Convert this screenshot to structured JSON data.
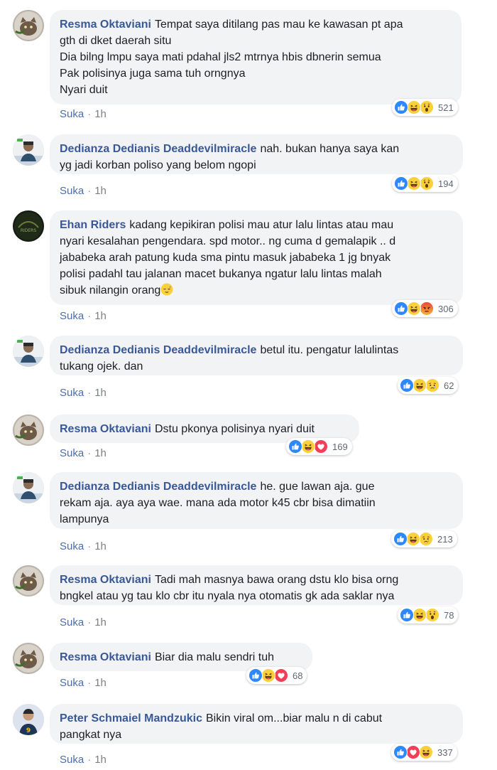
{
  "like_label": "Suka",
  "separator": "·",
  "colors": {
    "author": "#385898",
    "bubble": "#f2f3f5",
    "like": "#4b6ea9"
  },
  "comments": [
    {
      "author": "Resma Oktaviani",
      "lines": [
        "Tempat saya ditilang pas mau ke kawasan pt apa",
        "gth di dket daerah situ",
        "Dia bilng lmpu saya mati pdahal jls2 mtrnya hbis dbnerin semua",
        "Pak polisinya juga sama tuh orngnya",
        "Nyari duit"
      ],
      "time": "1h",
      "reactions": [
        "like-icon",
        "haha-icon",
        "wow-icon"
      ],
      "count": "521",
      "avatar": "cat"
    },
    {
      "author": "Dedianza Dedianis Deaddevilmiracle",
      "lines": [
        "nah. bukan hanya saya kan",
        "yg jadi korban poliso yang belom ngopi"
      ],
      "time": "1h",
      "reactions": [
        "like-icon",
        "haha-icon",
        "wow-icon"
      ],
      "count": "194",
      "avatar": "person"
    },
    {
      "author": "Ehan Riders",
      "lines": [
        "kadang kepikiran polisi mau atur lalu lintas atau mau",
        "nyari kesalahan pengendara. spd motor.. ng cuma d gemalapik .. d",
        "jababeka arah patung kuda sma pintu masuk jababeka 1 jg bnyak",
        "polisi padahl tau jalanan macet bukanya ngatur lalu lintas malah",
        "sibuk nilangin orang"
      ],
      "time": "1h",
      "reactions": [
        "like-icon",
        "haha-icon",
        "angry-icon"
      ],
      "count": "306",
      "avatar": "dark"
    },
    {
      "author": "Dedianza Dedianis Deaddevilmiracle",
      "lines": [
        "betul itu. pengatur lalulintas",
        "tukang ojek. dan"
      ],
      "time": "1h",
      "reactions": [
        "like-icon",
        "haha-icon",
        "sad-icon"
      ],
      "count": "62",
      "avatar": "person"
    },
    {
      "author": "Resma Oktaviani",
      "lines": [
        "Dstu pkonya polisinya nyari duit"
      ],
      "time": "1h",
      "reactions": [
        "like-icon",
        "haha-icon",
        "love-icon"
      ],
      "count": "169",
      "avatar": "cat"
    },
    {
      "author": "Dedianza Dedianis Deaddevilmiracle",
      "lines": [
        "he. gue lawan aja. gue",
        "rekam aja. aya aya wae. mana ada motor k45 cbr bisa dimatiin",
        "lampunya"
      ],
      "time": "1h",
      "reactions": [
        "like-icon",
        "haha-icon",
        "sad-icon"
      ],
      "count": "213",
      "avatar": "person"
    },
    {
      "author": "Resma Oktaviani",
      "lines": [
        "Tadi mah masnya bawa orang dstu klo bisa orng",
        "bngkel atau yg tau klo cbr itu nyala nya otomatis gk ada saklar nya"
      ],
      "time": "1h",
      "reactions": [
        "like-icon",
        "haha-icon",
        "wow-icon"
      ],
      "count": "78",
      "avatar": "cat"
    },
    {
      "author": "Resma Oktaviani",
      "lines": [
        "Biar dia malu sendri tuh"
      ],
      "time": "1h",
      "reactions": [
        "like-icon",
        "haha-icon",
        "love-icon"
      ],
      "count": "68",
      "avatar": "cat"
    },
    {
      "author": "Peter Schmaiel Mandzukic",
      "lines": [
        "Bikin viral om...biar malu n di cabut",
        "pangkat nya"
      ],
      "time": "1h",
      "reactions": [
        "like-icon",
        "love-icon",
        "haha-icon"
      ],
      "count": "337",
      "avatar": "soccer"
    }
  ]
}
